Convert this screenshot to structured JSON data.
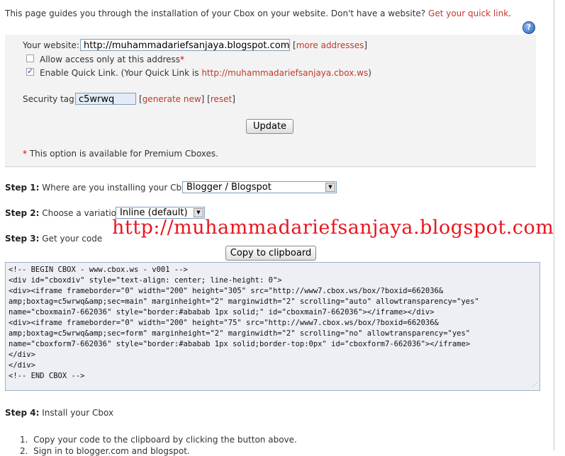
{
  "intro": {
    "text": "This page guides you through the installation of your Cbox on your website. Don't have a website?",
    "link": "Get your quick link",
    "end": "."
  },
  "help_icon": "?",
  "settings": {
    "website_label": "Your website:",
    "website_value": "http://muhammadariefsanjaya.blogspot.com",
    "more_addresses": "more addresses",
    "allow_access_label": "Allow access only at this address",
    "allow_access_checked": false,
    "enable_quick_link_label": "Enable Quick Link. (Your Quick Link is",
    "quick_link_url": "http://muhammadariefsanjaya.cbox.ws",
    "enable_quick_link_checked": true,
    "security_tag_label": "Security tag:",
    "security_tag_value": "c5wrwq",
    "generate_new": "generate new",
    "reset": "reset",
    "update_button": "Update",
    "premium_note": "This option is available for Premium Cboxes."
  },
  "steps": {
    "step1_label": "Step 1:",
    "step1_text": "Where are you installing your Cbox?",
    "step1_value": "Blogger / Blogspot",
    "step2_label": "Step 2:",
    "step2_text": "Choose a variation:",
    "step2_value": "Inline (default)",
    "step3_label": "Step 3:",
    "step3_text": "Get your code",
    "copy_button": "Copy to clipboard",
    "step4_label": "Step 4:",
    "step4_text": "Install your Cbox",
    "instructions": [
      "Copy your code to the clipboard by clicking the button above.",
      "Sign in to blogger.com and blogspot."
    ]
  },
  "watermark": "http://muhammadariefsanjaya.blogspot.com",
  "code": "<!-- BEGIN CBOX - www.cbox.ws - v001 -->\n<div id=\"cboxdiv\" style=\"text-align: center; line-height: 0\">\n<div><iframe frameborder=\"0\" width=\"200\" height=\"305\" src=\"http://www7.cbox.ws/box/?boxid=662036&\namp;boxtag=c5wrwq&amp;sec=main\" marginheight=\"2\" marginwidth=\"2\" scrolling=\"auto\" allowtransparency=\"yes\"\nname=\"cboxmain7-662036\" style=\"border:#ababab 1px solid;\" id=\"cboxmain7-662036\"></iframe></div>\n<div><iframe frameborder=\"0\" width=\"200\" height=\"75\" src=\"http://www7.cbox.ws/box/?boxid=662036&\namp;boxtag=c5wrwq&amp;sec=form\" marginheight=\"2\" marginwidth=\"2\" scrolling=\"no\" allowtransparency=\"yes\"\nname=\"cboxform7-662036\" style=\"border:#ababab 1px solid;border-top:0px\" id=\"cboxform7-662036\"></iframe>\n</div>\n</div>\n<!-- END CBOX -->"
}
